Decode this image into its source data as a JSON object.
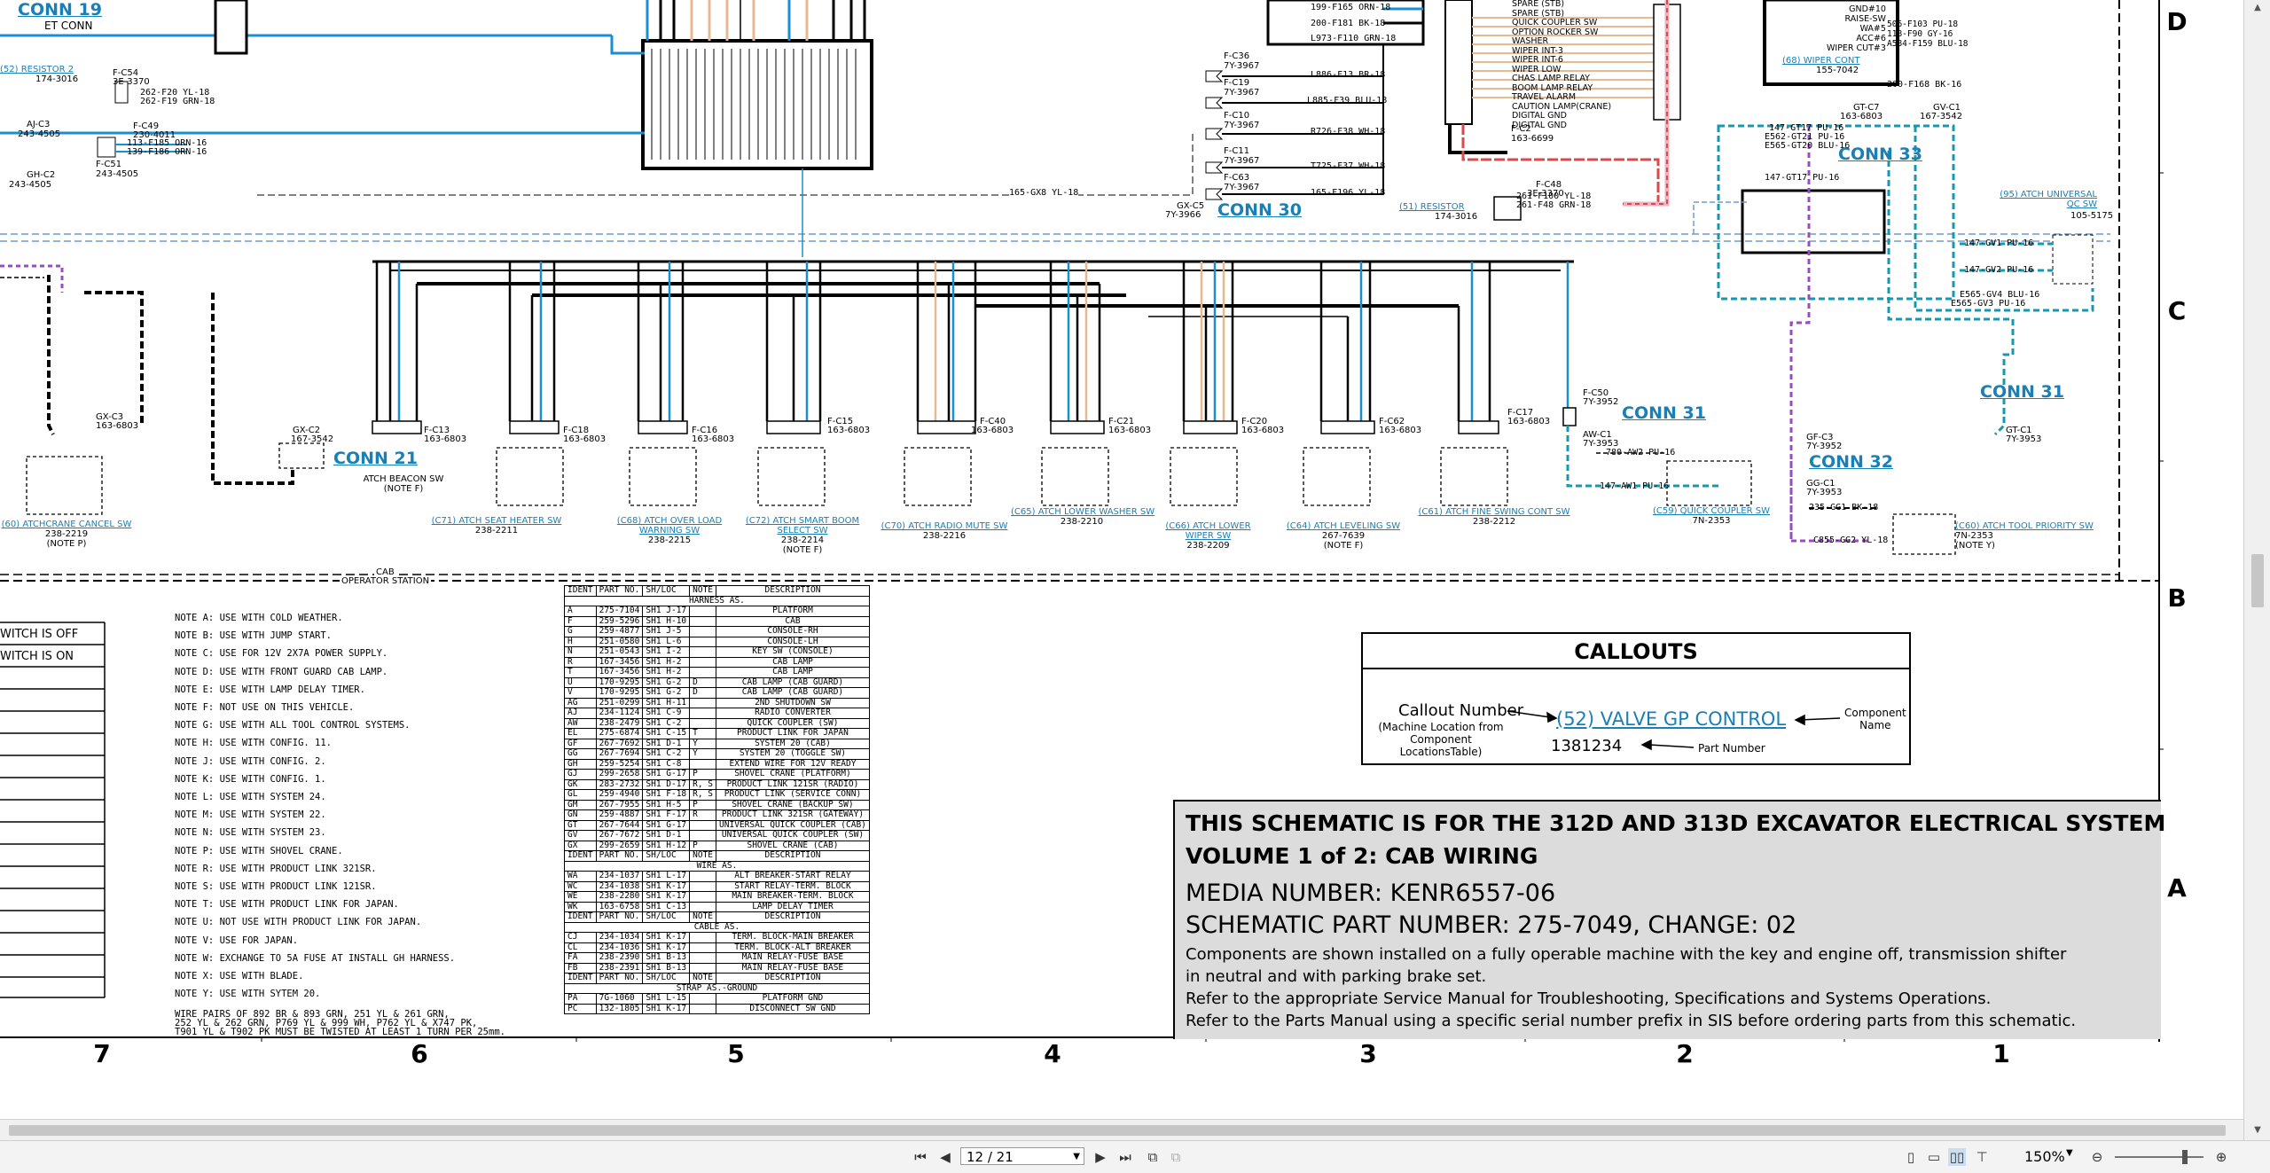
{
  "conn_labels": {
    "conn19": "CONN 19",
    "conn21": "CONN 21",
    "conn30": "CONN 30",
    "conn31a": "CONN 31",
    "conn31b": "CONN 31",
    "conn32": "CONN 32",
    "conn33": "CONN 33"
  },
  "conn19_sub": "ET CONN",
  "wire_labels": {
    "w1": "199-F165 ORN-18",
    "w2": "200-F181 BK-18",
    "w3": "L973-F110 GRN-18",
    "w4": "L886-F13 BR-18",
    "w5": "L885-F39 BLU-18",
    "w6": "R726-F38 WH-18",
    "w7": "T725-F37 WH-18",
    "w8": "165-F196 YL-18",
    "w9": "165-GX8 YL-18",
    "w10": "113-F185 ORN-16",
    "w11": "139-F186 ORN-16",
    "w12": "262-F20 YL-18",
    "w13": "262-F19 GRN-18",
    "w14": "261-F48 GRN-18",
    "w15": "261-F100 YL-18",
    "w16": "780-AW2 PU-16",
    "w17": "147-AW1 PU-16",
    "w18": "235-GG1 BK-18",
    "w19": "C855-GG2 YL-18",
    "w20": "147-GV1 PU-16",
    "w21": "147-GV2 PU-16",
    "w22": "E565-GV4 BLU-16",
    "w23": "E565-GV3 PU-16",
    "w24": "147-GT17 PU-16",
    "w25": "E562-GT21 PU-16",
    "w26": "E565-GT20 BLU-16",
    "w27": "147-GT17 PU-16"
  },
  "connectors": {
    "fc36": "F-C36",
    "fc36p": "7Y-3967",
    "fc19": "F-C19",
    "fc19p": "7Y-3967",
    "fc10": "F-C10",
    "fc10p": "7Y-3967",
    "fc11": "F-C11",
    "fc11p": "7Y-3967",
    "fc63": "F-C63",
    "fc63p": "7Y-3967",
    "gxc5": "GX-C5",
    "gxc5p": "7Y-3966",
    "fc54": "F-C54",
    "fc54p": "3E-3370",
    "fc49": "F-C49",
    "fc49p": "230-4011",
    "fc51": "F-C51",
    "fc51p": "243-4505",
    "ajc3": "AJ-C3",
    "ajc3p": "243-4505",
    "ghc2": "GH-C2",
    "ghc2p": "243-4505",
    "fc2": "F-C2",
    "fc2p": "163-6699",
    "fc48": "F-C48",
    "fc48p": "3E-3370",
    "gtc7": "GT-C7",
    "gtc7p": "163-6803",
    "gvc1": "GV-C1",
    "gvc1p": "167-3542",
    "gxc3": "GX-C3",
    "gxc3p": "163-6803",
    "gxc2": "GX-C2",
    "gxc2p": "167-3542",
    "fc13": "F-C13",
    "fc13p": "163-6803",
    "fc18": "F-C18",
    "fc18p": "163-6803",
    "fc16": "F-C16",
    "fc16p": "163-6803",
    "fc15": "F-C15",
    "fc15p": "163-6803",
    "fc40": "F-C40",
    "fc40p": "163-6803",
    "fc21": "F-C21",
    "fc21p": "163-6803",
    "fc20": "F-C20",
    "fc20p": "163-6803",
    "fc62": "F-C62",
    "fc62p": "163-6803",
    "fc17": "F-C17",
    "fc17p": "163-6803",
    "fc50": "F-C50",
    "fc50p": "7Y-3952",
    "awc1": "AW-C1",
    "awc1p": "7Y-3953",
    "gfc3": "GF-C3",
    "gfc3p": "7Y-3952",
    "ggc1": "GG-C1",
    "ggc1p": "7Y-3953",
    "gtc1": "GT-C1",
    "gtc1p": "7Y-3953"
  },
  "resistor_labels": {
    "r1": "(52) RESISTOR 2",
    "r1p": "174-3016",
    "r2": "(51) RESISTOR",
    "r2p": "174-3016"
  },
  "wiper": {
    "label": "(68) WIPER CONT",
    "part": "155-7042"
  },
  "atch_universal": {
    "label": "(95) ATCH UNIVERSAL QC SW",
    "part": "105-5175"
  },
  "switches": [
    {
      "label": "(60) ATCHCRANE CANCEL SW",
      "part": "238-2219",
      "note": "(NOTE P)"
    },
    {
      "label": "ATCH BEACON SW",
      "part": "",
      "note": "(NOTE F)"
    },
    {
      "label": "(C71) ATCH SEAT HEATER SW",
      "part": "238-2211",
      "note": ""
    },
    {
      "label": "(C68) ATCH OVER LOAD WARNING SW",
      "part": "238-2215",
      "note": ""
    },
    {
      "label": "(C72) ATCH SMART BOOM SELECT SW",
      "part": "238-2214",
      "note": "(NOTE F)"
    },
    {
      "label": "(C70) ATCH RADIO MUTE SW",
      "part": "238-2216",
      "note": ""
    },
    {
      "label": "(C65) ATCH LOWER WASHER SW",
      "part": "238-2210",
      "note": ""
    },
    {
      "label": "(C66) ATCH LOWER WIPER SW",
      "part": "238-2209",
      "note": ""
    },
    {
      "label": "(C64) ATCH LEVELING SW",
      "part": "267-7639",
      "note": "(NOTE F)"
    },
    {
      "label": "(C61) ATCH FINE SWING CONT SW",
      "part": "238-2212",
      "note": ""
    },
    {
      "label": "(C59) QUICK COUPLER SW",
      "part": "7N-2353",
      "note": ""
    },
    {
      "label": "(C60) ATCH TOOL PRIORITY SW",
      "part": "7N-2353",
      "note": "(NOTE Y)"
    }
  ],
  "panel_list": [
    "SPARE (STB)",
    "SPARE (STB)",
    "QUICK COUPLER SW",
    "OPTION ROCKER SW",
    "WASHER",
    "WIPER INT-3",
    "WIPER INT-6",
    "WIPER LOW",
    "CHAS LAMP RELAY",
    "BOOM LAMP RELAY",
    "TRAVEL ALARM",
    "CAUTION LAMP(CRANE)",
    "DIGITAL GND",
    "DIGITAL GND"
  ],
  "top_right_list": [
    "GND#10",
    "RAISE-SW",
    "WA#5",
    "ACC#6",
    "WIPER CUT#3"
  ],
  "top_right_wires": [
    "506-F103 PU-18",
    "118-F90 GY-16",
    "A584-F159 BLU-18",
    "200-F168 BK-16"
  ],
  "cab_label": "CAB",
  "operator_label": "OPERATOR STATION",
  "left_box": [
    "WITCH IS OFF",
    "WITCH IS ON"
  ],
  "notes": [
    "NOTE A: USE WITH COLD WEATHER.",
    "NOTE B: USE WITH JUMP START.",
    "NOTE C: USE FOR 12V 2X7A POWER SUPPLY.",
    "NOTE D: USE WITH FRONT GUARD CAB LAMP.",
    "NOTE E: USE WITH LAMP DELAY TIMER.",
    "NOTE F: NOT USE ON THIS VEHICLE.",
    "NOTE G: USE WITH ALL TOOL CONTROL SYSTEMS.",
    "NOTE H: USE WITH CONFIG. 11.",
    "NOTE J: USE WITH CONFIG. 2.",
    "NOTE K: USE WITH CONFIG. 1.",
    "NOTE L: USE WITH SYSTEM 24.",
    "NOTE M: USE WITH SYSTEM 22.",
    "NOTE N: USE WITH SYSTEM 23.",
    "NOTE P: USE WITH SHOVEL CRANE.",
    "NOTE R: USE WITH PRODUCT LINK 321SR.",
    "NOTE S: USE WITH PRODUCT LINK 121SR.",
    "NOTE T: USE WITH PRODUCT LINK FOR JAPAN.",
    "NOTE U: NOT USE WITH PRODUCT LINK FOR JAPAN.",
    "NOTE V: USE FOR JAPAN.",
    "NOTE W: EXCHANGE TO 5A FUSE AT INSTALL GH HARNESS.",
    "NOTE X: USE WITH BLADE.",
    "NOTE Y: USE WITH SYTEM 20."
  ],
  "wire_pairs_note": [
    "WIRE PAIRS OF 892 BR & 893 GRN, 251 YL & 261 GRN,",
    "252 YL & 262 GRN, P769 YL & 999 WH, P762 YL & X747 PK,",
    "T901 YL & T902 PK MUST BE TWISTED AT LEAST 1 TURN PER 25mm."
  ],
  "table_header": [
    "IDENT",
    "PART NO.",
    "SH/LOC",
    "NOTE",
    "DESCRIPTION"
  ],
  "table_sections": [
    {
      "title": "HARNESS AS.",
      "rows": [
        [
          "A",
          "275-7104",
          "SH1 J-17",
          "",
          "PLATFORM"
        ],
        [
          "F",
          "259-5296",
          "SH1 H-10",
          "",
          "CAB"
        ],
        [
          "G",
          "259-4877",
          "SH1 J-5",
          "",
          "CONSOLE-RH"
        ],
        [
          "H",
          "251-0580",
          "SH1 L-6",
          "",
          "CONSOLE-LH"
        ],
        [
          "N",
          "251-0543",
          "SH1 I-2",
          "",
          "KEY SW (CONSOLE)"
        ],
        [
          "R",
          "167-3456",
          "SH1 H-2",
          "",
          "CAB LAMP"
        ],
        [
          "T",
          "167-3456",
          "SH1 H-2",
          "",
          "CAB LAMP"
        ],
        [
          "U",
          "170-9295",
          "SH1 G-2",
          "D",
          "CAB LAMP (CAB GUARD)"
        ],
        [
          "V",
          "170-9295",
          "SH1 G-2",
          "D",
          "CAB LAMP (CAB GUARD)"
        ],
        [
          "AG",
          "251-0299",
          "SH1 H-11",
          "",
          "2ND SHUTDOWN SW"
        ],
        [
          "AJ",
          "234-1124",
          "SH1 C-9",
          "",
          "RADIO CONVERTER"
        ],
        [
          "AW",
          "238-2479",
          "SH1 C-2",
          "",
          "QUICK COUPLER (SW)"
        ],
        [
          "EL",
          "275-6874",
          "SH1 C-15",
          "T",
          "PRODUCT LINK FOR JAPAN"
        ],
        [
          "GF",
          "267-7692",
          "SH1 D-1",
          "Y",
          "SYSTEM 20 (CAB)"
        ],
        [
          "GG",
          "267-7694",
          "SH1 C-2",
          "Y",
          "SYSTEM 20 (TOGGLE SW)"
        ],
        [
          "GH",
          "259-5254",
          "SH1 C-8",
          "",
          "EXTEND WIRE FOR 12V READY"
        ],
        [
          "GJ",
          "299-2658",
          "SH1 G-17",
          "P",
          "SHOVEL CRANE (PLATFORM)"
        ],
        [
          "GK",
          "283-2732",
          "SH1 D-17",
          "R, S",
          "PRODUCT LINK 121SR (RADIO)"
        ],
        [
          "GL",
          "259-4940",
          "SH1 F-18",
          "R, S",
          "PRODUCT LINK (SERVICE CONN)"
        ],
        [
          "GM",
          "267-7955",
          "SH1 H-5",
          "P",
          "SHOVEL CRANE (BACKUP SW)"
        ],
        [
          "GN",
          "259-4887",
          "SH1 F-17",
          "R",
          "PRODUCT LINK 321SR (GATEWAY)"
        ],
        [
          "GT",
          "267-7644",
          "SH1 G-17",
          "",
          "UNIVERSAL QUICK COUPLER (CAB)"
        ],
        [
          "GV",
          "267-7672",
          "SH1 D-1",
          "",
          "UNIVERSAL QUICK COUPLER (SW)"
        ],
        [
          "GX",
          "299-2659",
          "SH1 H-12",
          "P",
          "SHOVEL CRANE (CAB)"
        ]
      ]
    },
    {
      "title": "WIRE AS.",
      "rows": [
        [
          "WA",
          "234-1037",
          "SH1 L-17",
          "",
          "ALT BREAKER-START RELAY"
        ],
        [
          "WC",
          "234-1038",
          "SH1 K-17",
          "",
          "START RELAY-TERM. BLOCK"
        ],
        [
          "WE",
          "238-2280",
          "SH1 K-17",
          "",
          "MAIN BREAKER-TERM. BLOCK"
        ],
        [
          "WK",
          "163-6758",
          "SH1 C-13",
          "",
          "LAMP DELAY TIMER"
        ]
      ]
    },
    {
      "title": "CABLE AS.",
      "rows": [
        [
          "CJ",
          "234-1034",
          "SH1 K-17",
          "",
          "TERM. BLOCK-MAIN BREAKER"
        ],
        [
          "CL",
          "234-1036",
          "SH1 K-17",
          "",
          "TERM. BLOCK-ALT BREAKER"
        ],
        [
          "FA",
          "238-2390",
          "SH1 B-13",
          "",
          "MAIN RELAY-FUSE BASE"
        ],
        [
          "FB",
          "238-2391",
          "SH1 B-13",
          "",
          "MAIN RELAY-FUSE BASE"
        ]
      ]
    },
    {
      "title": "STRAP AS.-GROUND",
      "rows": [
        [
          "PA",
          "7G-1060",
          "SH1 L-15",
          "",
          "PLATFORM GND"
        ],
        [
          "PC",
          "132-1805",
          "SH1 K-17",
          "",
          "DISCONNECT SW GND"
        ]
      ]
    }
  ],
  "callouts": {
    "title": "CALLOUTS",
    "callout_number": "Callout Number",
    "machine_location": "(Machine Location from",
    "component_locations": "Component LocationsTable)",
    "example": "(52) VALVE GP  CONTROL",
    "part": "1381234",
    "component": "Component",
    "name": "Name",
    "part_number": "Part Number"
  },
  "title_block": {
    "line1": "THIS SCHEMATIC IS FOR THE 312D AND 313D EXCAVATOR ELECTRICAL SYSTEM",
    "line2": "VOLUME 1 of 2: CAB WIRING",
    "line3": "MEDIA NUMBER: KENR6557-06",
    "line4": "SCHEMATIC PART NUMBER: 275-7049, CHANGE: 02",
    "body": [
      "Components are shown installed on a fully operable machine with the key and engine off, transmission shifter",
      "in neutral and with parking brake set.",
      "Refer to the appropriate Service Manual for Troubleshooting, Specifications and Systems Operations.",
      "Refer to the Parts Manual using a specific serial number prefix in SIS before ordering parts from this schematic."
    ]
  },
  "row_labels": [
    "D",
    "C",
    "B",
    "A"
  ],
  "col_labels": [
    "7",
    "6",
    "5",
    "4",
    "3",
    "2",
    "1"
  ],
  "viewer": {
    "page": "12 / 21",
    "zoom": "150%"
  },
  "colors": {
    "wire_blue": "#1a8fd0",
    "wire_teal": "#1598b0",
    "wire_orange": "#e8b890",
    "wire_purple": "#9b4bc0",
    "wire_red": "#d94a4a",
    "wire_pink": "#f0b0c0",
    "link": "#1a7fb5",
    "title_bg": "#dcdcdc"
  }
}
